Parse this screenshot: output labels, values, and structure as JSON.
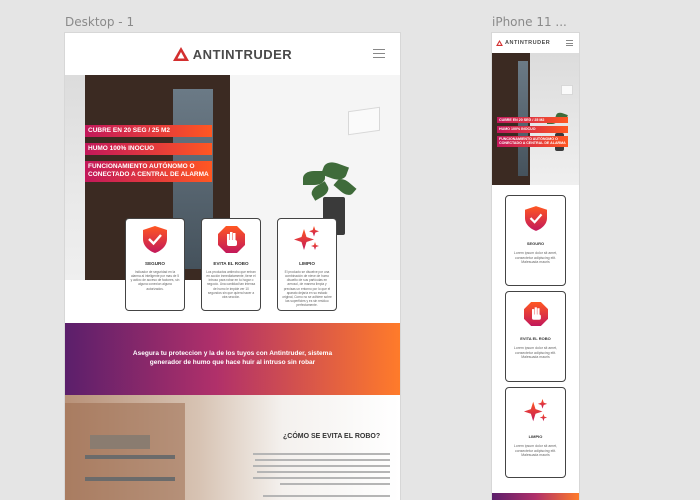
{
  "frames": {
    "desktop_label": "Desktop - 1",
    "iphone_label": "iPhone 11 ..."
  },
  "brand": {
    "name": "ANTINTRUDER"
  },
  "colors": {
    "canvas": "#e5e5e5",
    "accent_red": "#c2185b",
    "accent_orange": "#ff5722",
    "banner_purple": "#5b1f6b"
  },
  "hero": {
    "tags": [
      "CUBRE EN 20 SEG / 25 M2",
      "HUMO 100% INOCUO",
      "FUNCIONAMIENTO AUTÓNOMO O\nCONECTADO A CENTRAL DE ALARMA"
    ]
  },
  "features": [
    {
      "icon": "shield-check-icon",
      "title": "SEGURO",
      "desktop_text": "Indicador de seguridad en la alarma al inteligente por mas de 5 y activo de acceso de factores, sin alguna conexion alguna autorizados.",
      "mobile_text": "Lorem ipsum dolor sit amet, consectetur adipiscing elit. Malesuada mauris"
    },
    {
      "icon": "stop-hand-icon",
      "title": "EVITA EL ROBO",
      "desktop_text": "Los productos antirrobo que entran en acción inmediatamente, tiene el intruso para robar en tu hogar o negocio. Una cantidad tan intensa de humo le impide ver 10 segundos sin que quiera hacer a otra sección.",
      "mobile_text": "Lorem ipsum dolor sit amet, consectetur adipiscing elit. Malesuada mauris"
    },
    {
      "icon": "sparkle-icon",
      "title": "LIMPIO",
      "desktop_text": "El producto se disuelve por una combinación de nieve de humo disuelto de sus partículas en aerosol, de manera limpia y precisas un entorno por lo que el aparato dejaría en su estado original, Como no se adhiere sobre las superficies y es sin residuo perfectamente.",
      "mobile_text": "Lorem ipsum dolor sit amet, consectetur adipiscing elit. Malesuada mauris"
    }
  ],
  "banner": {
    "text": "Asegura tu proteccion y la de los tuyos con Antintruder, sistema generador de humo que hace huir al intruso sin robar"
  },
  "section2": {
    "title": "¿CÓMO SE EVITA EL ROBO?"
  }
}
